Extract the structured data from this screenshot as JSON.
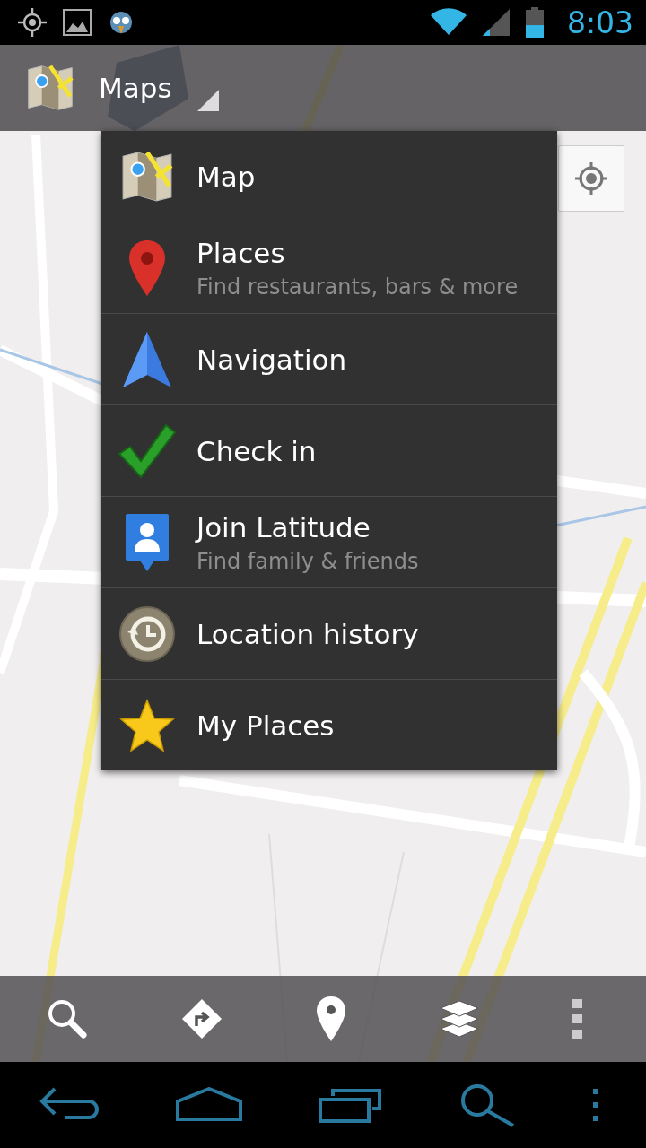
{
  "status_bar": {
    "time": "8:03"
  },
  "action_bar": {
    "title": "Maps"
  },
  "menu": {
    "items": [
      {
        "title": "Map"
      },
      {
        "title": "Places",
        "subtitle": "Find restaurants, bars & more"
      },
      {
        "title": "Navigation"
      },
      {
        "title": "Check in"
      },
      {
        "title": "Join Latitude",
        "subtitle": "Find family & friends"
      },
      {
        "title": "Location history"
      },
      {
        "title": "My Places"
      }
    ]
  }
}
